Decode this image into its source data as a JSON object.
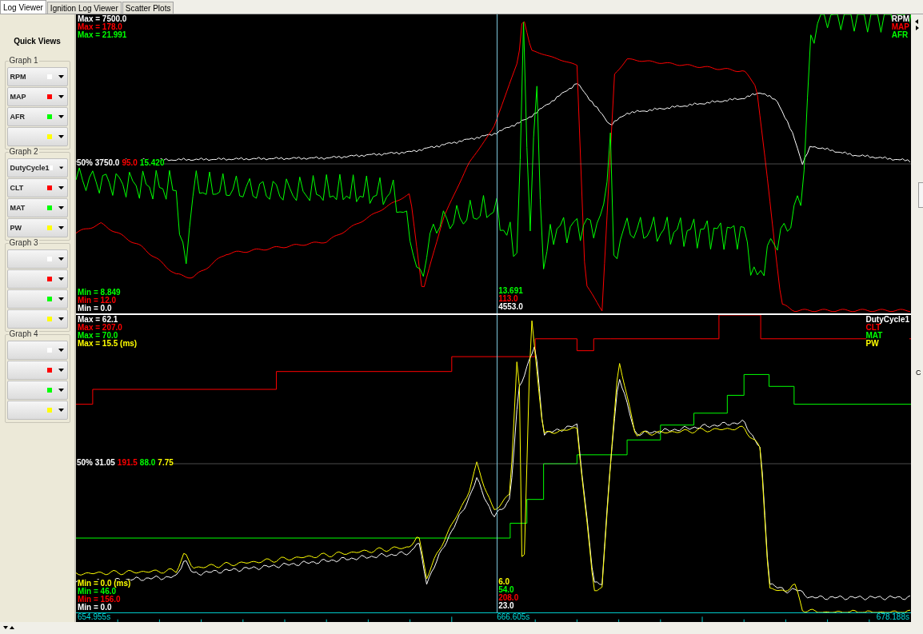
{
  "tabs": [
    {
      "label": "Log Viewer",
      "selected": true
    },
    {
      "label": "Ignition Log Viewer",
      "selected": false
    },
    {
      "label": "Scatter Plots",
      "selected": false
    }
  ],
  "sidebar": {
    "title": "Quick Views",
    "groups": [
      {
        "title": "Graph 1",
        "channels": [
          {
            "label": "RPM",
            "color": "#ffffff"
          },
          {
            "label": "MAP",
            "color": "#ff0000"
          },
          {
            "label": "AFR",
            "color": "#00ff00"
          },
          {
            "color": "#ffff00"
          }
        ]
      },
      {
        "title": "Graph 2",
        "channels": [
          {
            "label": "DutyCycle1",
            "color": "#ffffff"
          },
          {
            "label": "CLT",
            "color": "#ff0000"
          },
          {
            "label": "MAT",
            "color": "#00ff00"
          },
          {
            "label": "PW",
            "color": "#ffff00"
          }
        ]
      },
      {
        "title": "Graph 3",
        "channels": [
          {
            "color": "#ffffff"
          },
          {
            "color": "#ff0000"
          },
          {
            "color": "#00ff00"
          },
          {
            "color": "#ffff00"
          }
        ]
      },
      {
        "title": "Graph 4",
        "channels": [
          {
            "color": "#ffffff"
          },
          {
            "color": "#ff0000"
          },
          {
            "color": "#00ff00"
          },
          {
            "color": "#ffff00"
          }
        ]
      }
    ]
  },
  "graphs": [
    {
      "max_labels": [
        {
          "text": "Max = 7500.0",
          "color": "#ffffff"
        },
        {
          "text": "Max = 178.0",
          "color": "#ff0000"
        },
        {
          "text": "Max = 21.991",
          "color": "#00ff00"
        }
      ],
      "midline": [
        {
          "text": "50% 3750.0",
          "color": "#ffffff"
        },
        {
          "text": "95.0",
          "color": "#ff0000"
        },
        {
          "text": "15.420",
          "color": "#00ff00"
        }
      ],
      "min_labels": [
        {
          "text": "Min = 8.849",
          "color": "#00ff00"
        },
        {
          "text": "Min = 12.0",
          "color": "#ff0000"
        },
        {
          "text": "Min = 0.0",
          "color": "#ffffff"
        }
      ],
      "cursor_values": [
        {
          "text": "13.691",
          "color": "#00ff00"
        },
        {
          "text": "113.0",
          "color": "#ff0000"
        },
        {
          "text": "4553.0",
          "color": "#ffffff"
        }
      ],
      "legend": [
        {
          "text": "RPM",
          "color": "#ffffff"
        },
        {
          "text": "MAP",
          "color": "#ff0000"
        },
        {
          "text": "AFR",
          "color": "#00ff00"
        }
      ]
    },
    {
      "max_labels": [
        {
          "text": "Max = 62.1",
          "color": "#ffffff"
        },
        {
          "text": "Max = 207.0",
          "color": "#ff0000"
        },
        {
          "text": "Max = 70.0",
          "color": "#00ff00"
        },
        {
          "text": "Max = 15.5 (ms)",
          "color": "#ffff00"
        }
      ],
      "midline": [
        {
          "text": "50% 31.05",
          "color": "#ffffff"
        },
        {
          "text": "191.5",
          "color": "#ff0000"
        },
        {
          "text": "88.0",
          "color": "#00ff00"
        },
        {
          "text": "7.75",
          "color": "#ffff00"
        }
      ],
      "min_labels": [
        {
          "text": "Min = 0.0 (ms)",
          "color": "#ffff00"
        },
        {
          "text": "Min = 46.0",
          "color": "#00ff00"
        },
        {
          "text": "Min = 156.0",
          "color": "#ff0000"
        },
        {
          "text": "Min = 0.0",
          "color": "#ffffff"
        }
      ],
      "cursor_values": [
        {
          "text": "6.0",
          "color": "#ffff00"
        },
        {
          "text": "54.0",
          "color": "#00ff00"
        },
        {
          "text": "208.0",
          "color": "#ff0000"
        },
        {
          "text": "23.0",
          "color": "#ffffff"
        }
      ],
      "legend": [
        {
          "text": "DutyCycle1",
          "color": "#ffffff"
        },
        {
          "text": "CLT",
          "color": "#ff0000"
        },
        {
          "text": "MAT",
          "color": "#00ff00"
        },
        {
          "text": "PW",
          "color": "#ffff00"
        }
      ]
    }
  ],
  "timeline": {
    "start": "654.955s",
    "cursor": "666.605s",
    "end": "678.188s"
  },
  "right_strip": {
    "label": "C"
  }
}
